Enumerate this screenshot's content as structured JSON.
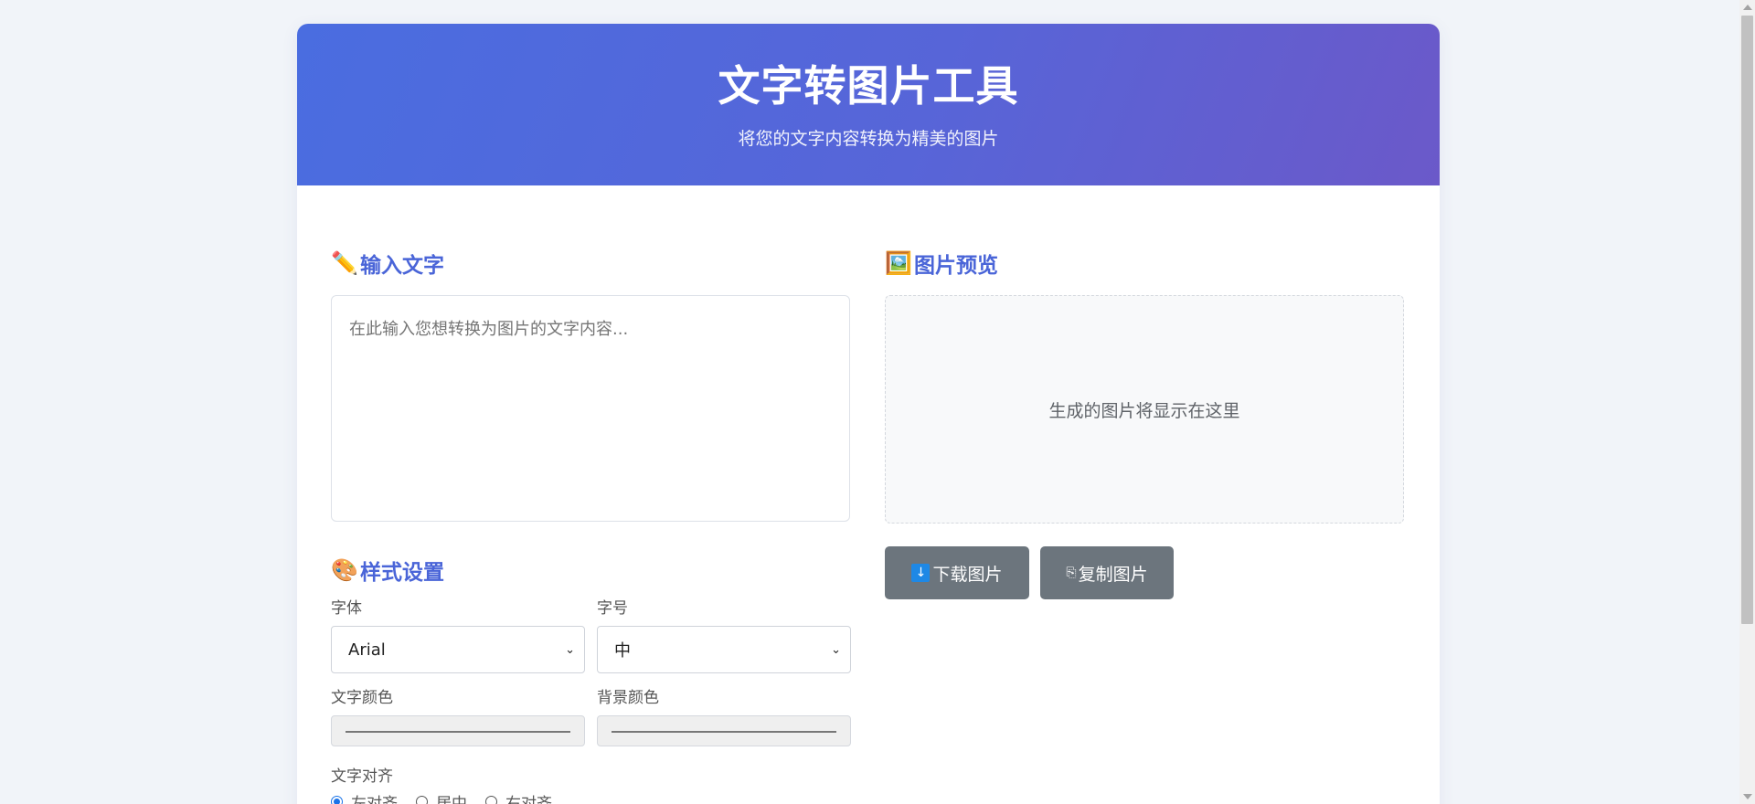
{
  "header": {
    "title": "文字转图片工具",
    "subtitle": "将您的文字内容转换为精美的图片"
  },
  "input_section": {
    "icon": "pencil-icon",
    "icon_glyph": "✏️",
    "title": "输入文字",
    "placeholder": "在此输入您想转换为图片的文字内容..."
  },
  "style_section": {
    "icon": "palette-icon",
    "icon_glyph": "🎨",
    "title": "样式设置",
    "font_label": "字体",
    "font_value": "Arial",
    "size_label": "字号",
    "size_value": "中",
    "text_color_label": "文字颜色",
    "bg_color_label": "背景颜色",
    "align_label": "文字对齐",
    "align_options": [
      "左对齐",
      "居中",
      "右对齐"
    ],
    "align_selected": "左对齐"
  },
  "preview_section": {
    "icon": "framed-picture-icon",
    "icon_glyph": "🖼️",
    "title": "图片预览",
    "placeholder_text": "生成的图片将显示在这里"
  },
  "actions": {
    "download_icon": "↓",
    "download_label": "下载图片",
    "copy_icon": "⎘",
    "copy_label": "复制图片"
  },
  "colors": {
    "header_gradient_start": "#4a6de0",
    "header_gradient_end": "#6b59c9",
    "section_title": "#4a65d8",
    "button_bg": "#6c757d",
    "radio_checked": "#1a73e8"
  }
}
